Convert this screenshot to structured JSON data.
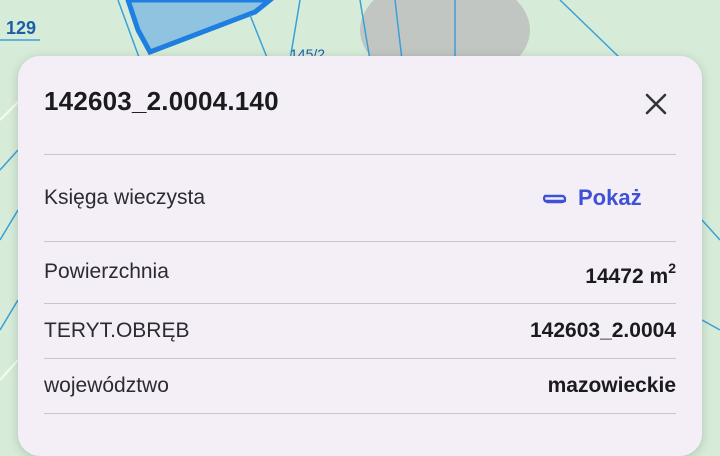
{
  "map": {
    "road_label": "129",
    "parcel_label": "145/2"
  },
  "panel": {
    "title": "142603_2.0004.140",
    "close_icon": "close-icon",
    "land_register": {
      "label": "Księga wieczysta",
      "link_label": "Pokaż",
      "link_icon": "paperclip-icon"
    },
    "rows": [
      {
        "label": "Powierzchnia",
        "value": "14472",
        "unit": "m",
        "unit_sup": "2"
      },
      {
        "label": "TERYT.OBRĘB",
        "value": "142603_2.0004"
      },
      {
        "label": "województwo",
        "value": "mazowieckie"
      }
    ]
  },
  "colors": {
    "accent": "#3f51d6",
    "map_background": "#d6ecd8",
    "parcel_fill": "#8fc3e0",
    "parcel_border": "#1e7fe0",
    "sheet_background": "#f4eff7"
  }
}
